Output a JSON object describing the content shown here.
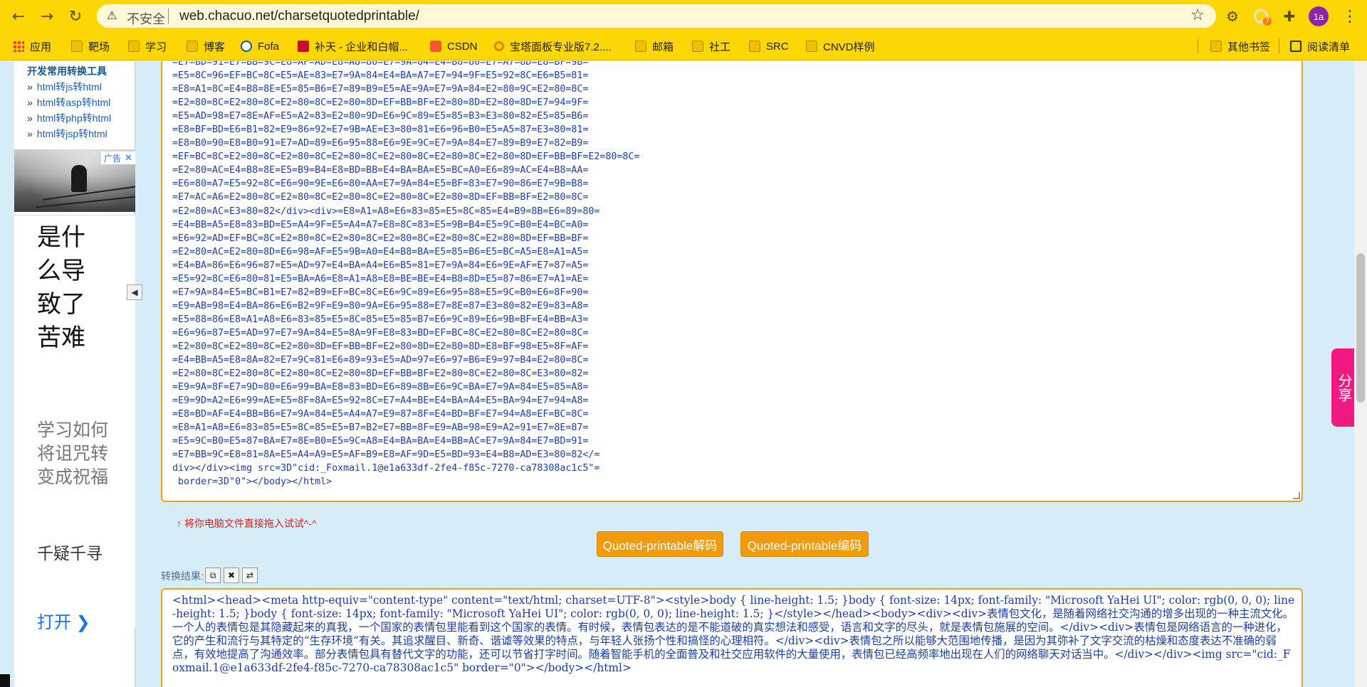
{
  "browser": {
    "security_label": "不安全",
    "url": "web.chacuo.net/charsetquotedprintable/",
    "profile_initials": "1a",
    "ext_badge": "7"
  },
  "bookmarks": [
    {
      "label": "应用",
      "icon": "apps-grid-icon"
    },
    {
      "label": "靶场",
      "icon": "folder-icon"
    },
    {
      "label": "学习",
      "icon": "folder-icon"
    },
    {
      "label": "博客",
      "icon": "folder-icon"
    },
    {
      "label": "Fofa",
      "icon": "fofa-icon"
    },
    {
      "label": "补天 - 企业和白帽...",
      "icon": "butian-icon"
    },
    {
      "label": "CSDN",
      "icon": "csdn-icon"
    },
    {
      "label": "宝塔面板专业版7.2....",
      "icon": "search-icon"
    },
    {
      "label": "邮箱",
      "icon": "folder-icon"
    },
    {
      "label": "社工",
      "icon": "folder-icon"
    },
    {
      "label": "SRC",
      "icon": "folder-icon"
    },
    {
      "label": "CNVD样例",
      "icon": "folder-icon"
    },
    {
      "label": "其他书签",
      "icon": "folder-icon"
    },
    {
      "label": "阅读清单",
      "icon": "reading-list-icon"
    }
  ],
  "sidebar": {
    "title": "开发常用转换工具",
    "links": [
      "html转js转html",
      "html转asp转html",
      "html转php转html",
      "html转jsp转html"
    ]
  },
  "ad": {
    "badge": "广告",
    "headline": "是什么导致了苦难",
    "sub": "学习如何将诅咒转变成祝福",
    "name": "千疑千寻",
    "open": "打开 ❯"
  },
  "input_text": "=E7=BD=91=E7=BB=9C=E8=AF=AD=E8=A8=80=E7=9A=84=E4=B8=80=E7=A7=8D=E8=BF=9B=\n=E5=8C=96=EF=BC=8C=E5=AE=83=E7=9A=84=E4=BA=A7=E7=94=9F=E5=92=8C=E6=B5=81=\n=E8=A1=8C=E4=B8=8E=E5=85=B6=E7=89=B9=E5=AE=9A=E7=9A=84=E2=80=9C=E2=80=8C=\n=E2=80=8C=E2=80=8C=E2=80=8C=E2=80=8D=EF=BB=BF=E2=80=8D=E2=80=8D=E7=94=9F=\n=E5=AD=98=E7=8E=AF=E5=A2=83=E2=80=9D=E6=9C=89=E5=85=B3=E3=80=82=E5=85=B6=\n=E8=BF=BD=E6=B1=82=E9=86=92=E7=9B=AE=E3=80=81=E6=96=B0=E5=A5=87=E3=80=81=\n=E8=B0=90=E8=B0=91=E7=AD=89=E6=95=88=E6=9E=9C=E7=9A=84=E7=89=B9=E7=82=B9=\n=EF=BC=8C=E2=80=8C=E2=80=8C=E2=80=8C=E2=80=8C=E2=80=8C=E2=80=8D=EF=BB=BF=E2=80=8C=\n=E2=80=AC=E4=B8=8E=E5=B9=B4=E8=BD=BB=E4=BA=BA=E5=BC=A0=E6=89=AC=E4=B8=AA=\n=E6=80=A7=E5=92=8C=E6=90=9E=E6=80=AA=E7=9A=84=E5=BF=83=E7=90=86=E7=9B=B8=\n=E7=AC=A6=E2=80=8C=E2=80=8C=E2=80=8C=E2=80=8C=E2=80=8D=EF=BB=BF=E2=80=8C=\n=E2=80=AC=E3=80=82</div><div>=E8=A1=A8=E6=83=85=E5=8C=85=E4=B9=8B=E6=89=80=\n=E4=BB=A5=E8=83=BD=E5=A4=9F=E5=A4=A7=E8=8C=83=E5=9B=B4=E5=9C=B0=E4=BC=A0=\n=E6=92=AD=EF=BC=8C=E2=80=8C=E2=80=8C=E2=80=8C=E2=80=8C=E2=80=8D=EF=BB=BF=\n=E2=80=AC=E2=80=8D=E6=98=AF=E5=9B=A0=E4=B8=BA=E5=85=B6=E5=BC=A5=E8=A1=A5=\n=E4=BA=86=E6=96=87=E5=AD=97=E4=BA=A4=E6=B5=81=E7=9A=84=E6=9E=AF=E7=87=A5=\n=E5=92=8C=E6=80=81=E5=BA=A6=E8=A1=A8=E8=BE=BE=E4=B8=8D=E5=87=86=E7=A1=AE=\n=E7=9A=84=E5=BC=B1=E7=82=B9=EF=BC=8C=E6=9C=89=E6=95=88=E5=9C=B0=E6=8F=90=\n=E9=AB=98=E4=BA=86=E6=B2=9F=E9=80=9A=E6=95=88=E7=8E=87=E3=80=82=E9=83=A8=\n=E5=88=86=E8=A1=A8=E6=83=85=E5=8C=85=E5=85=B7=E6=9C=89=E6=9B=BF=E4=BB=A3=\n=E6=96=87=E5=AD=97=E7=9A=84=E5=8A=9F=E8=83=BD=EF=BC=8C=E2=80=8C=E2=80=8C=\n=E2=80=8C=E2=80=8C=E2=80=8D=EF=BB=BF=E2=80=8D=E2=80=8D=E8=BF=98=E5=8F=AF=\n=E4=BB=A5=E8=8A=82=E7=9C=81=E6=89=93=E5=AD=97=E6=97=B6=E9=97=B4=E2=80=8C=\n=E2=80=8C=E2=80=8C=E2=80=8C=E2=80=8D=EF=BB=BF=E2=80=8C=E2=80=8C=E3=80=82=\n=E9=9A=8F=E7=9D=80=E6=99=BA=E8=83=BD=E6=89=8B=E6=9C=BA=E7=9A=84=E5=85=A8=\n=E9=9D=A2=E6=99=AE=E5=8F=8A=E5=92=8C=E7=A4=BE=E4=BA=A4=E5=BA=94=E7=94=A8=\n=E8=BD=AF=E4=BB=B6=E7=9A=84=E5=A4=A7=E9=87=8F=E4=BD=BF=E7=94=A8=EF=BC=8C=\n=E8=A1=A8=E6=83=85=E5=8C=85=E5=B7=B2=E7=BB=8F=E9=AB=98=E9=A2=91=E7=8E=87=\n=E5=9C=B0=E5=87=BA=E7=8E=B0=E5=9C=A8=E4=BA=BA=E4=BB=AC=E7=9A=84=E7=BD=91=\n=E7=BB=9C=E8=81=8A=E5=A4=A9=E5=AF=B9=E8=AF=9D=E5=BD=93=E4=B8=AD=E3=80=82</=\ndiv></div><img src=3D\"cid:_Foxmail.1@e1a633df-2fe4-f85c-7270-ca78308ac1c5\"=\n border=3D\"0\"></body></html>",
  "hint": "↑ 将你电脑文件直接拖入试试^-^",
  "buttons": {
    "decode": "Quoted-printable解码",
    "encode": "Quoted-printable编码"
  },
  "result": {
    "label": "转换结果:",
    "output": "<html><head><meta http-equiv=\"content-type\" content=\"text/html; charset=UTF-8\"><style>body { line-height: 1.5; }body { font-size: 14px; font-family: \"Microsoft YaHei UI\"; color: rgb(0, 0, 0); line-height: 1.5; }body { font-size: 14px; font-family: \"Microsoft YaHei UI\"; color: rgb(0, 0, 0); line-height: 1.5; }</style></head><body><div><div>表情包文化，是随着网络社交沟通的增多出现的一种主流文化。一个人的表情包是其隐藏起来的真我，一个国家的表情包里能看到这个国家的表情。有时候，表情包表达的是不能道破的真实想法和感受，语言和文字的尽头，就是表情包施展的空间。</div><div>表情包是网络语言的一种进化，它的产生和流行与其特定的“生存环境”有关。其追求醒目、新奇、谐谑等效果的特点，与年轻人张扬个性和搞怪的心理相符。</div><div>表情包之所以能够大范围地传播，是因为其弥补了文字交流的枯燥和态度表达不准确的弱点，有效地提高了沟通效率。部分表情包具有替代文字的功能，还可以节省打字时间。随着智能手机的全面普及和社交应用软件的大量使用，表情包已经高频率地出现在人们的网络聊天对话当中。</div></div><img src=\"cid:_Foxmail.1@e1a633df-2fe4-f85c-7270-ca78308ac1c5\" border=\"0\"></body></html>"
  },
  "share": "分享"
}
